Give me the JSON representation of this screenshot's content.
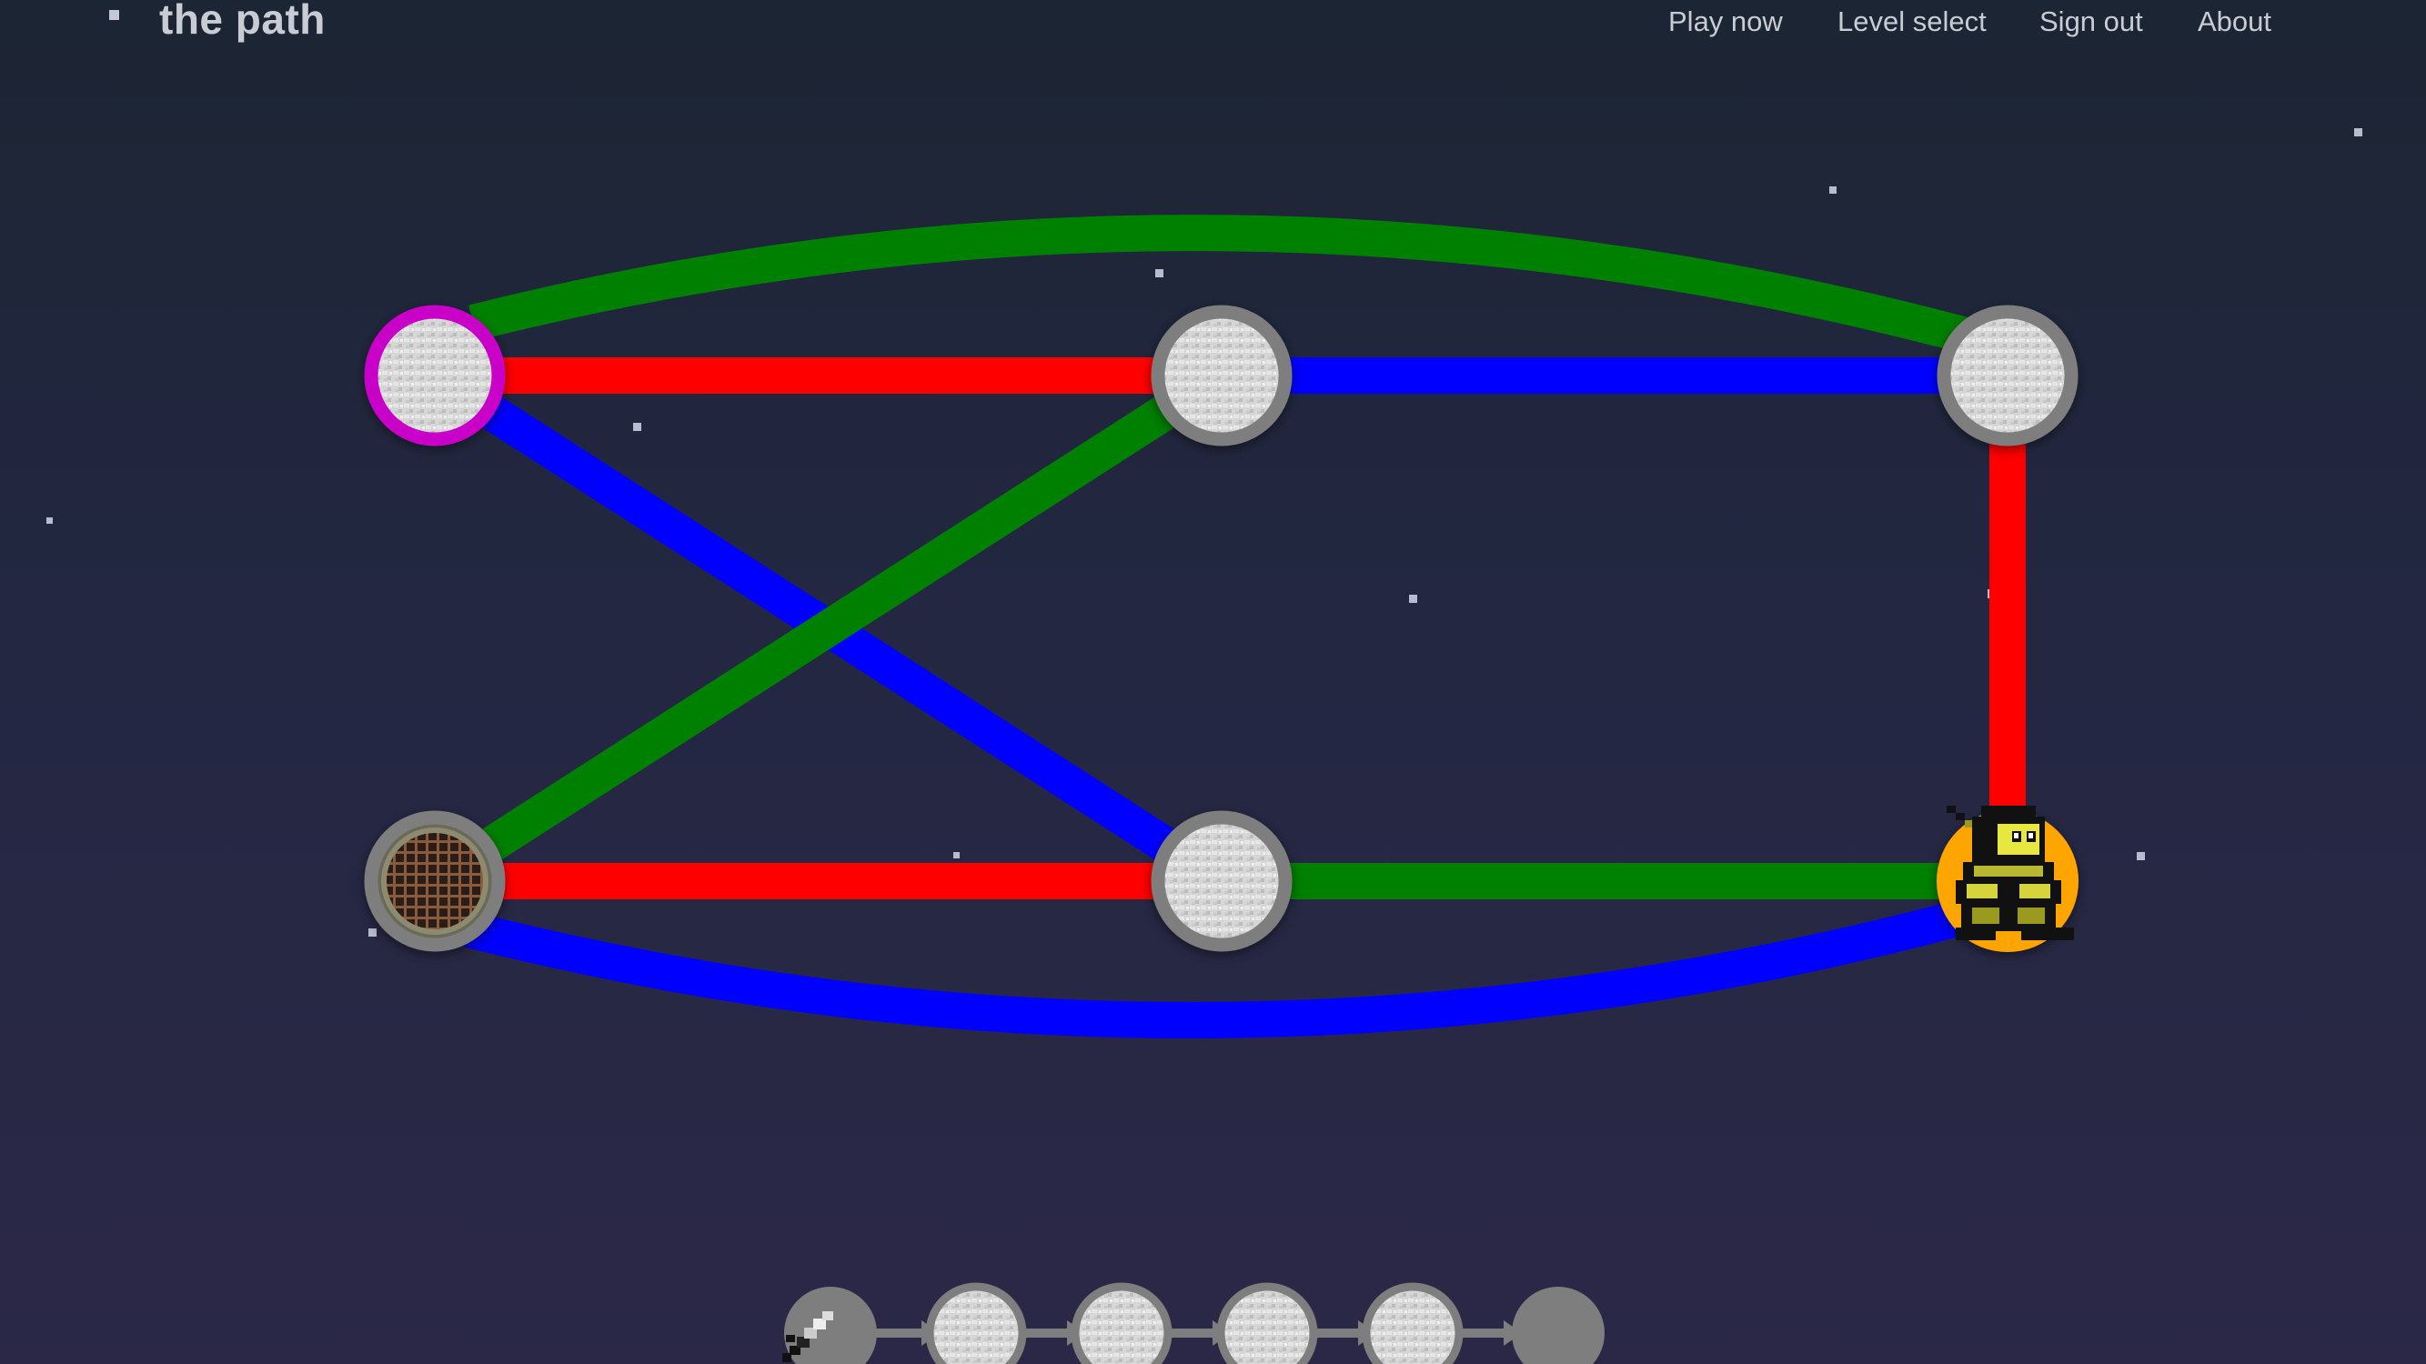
{
  "nav": {
    "title": "the path",
    "links": [
      "Play now",
      "Level select",
      "Sign out",
      "About"
    ]
  },
  "colors": {
    "red": "#ff0000",
    "green": "#008000",
    "blue": "#0000ff",
    "node_ring_default": "#7e7e7e",
    "node_ring_start": "#c800c8",
    "node_ring_player": "#ffa500",
    "stone": "#d4d4d4"
  },
  "board": {
    "nodes": [
      {
        "id": "top-left",
        "state": "start",
        "icon": "stone-icon"
      },
      {
        "id": "top-middle",
        "state": "default",
        "icon": "stone-icon"
      },
      {
        "id": "top-right",
        "state": "default",
        "icon": "stone-icon"
      },
      {
        "id": "bottom-left",
        "state": "default",
        "icon": "sewer-grate-icon"
      },
      {
        "id": "bottom-middle",
        "state": "default",
        "icon": "stone-icon"
      },
      {
        "id": "bottom-right",
        "state": "player",
        "icon": "ninja-character-icon"
      }
    ],
    "edges": [
      {
        "from": "top-left",
        "to": "top-middle",
        "color": "red"
      },
      {
        "from": "top-middle",
        "to": "top-right",
        "color": "blue"
      },
      {
        "from": "top-left",
        "to": "top-right",
        "color": "green"
      },
      {
        "from": "top-right",
        "to": "bottom-right",
        "color": "red"
      },
      {
        "from": "top-left",
        "to": "bottom-middle",
        "color": "blue"
      },
      {
        "from": "top-middle",
        "to": "bottom-left",
        "color": "green"
      },
      {
        "from": "bottom-left",
        "to": "bottom-middle",
        "color": "red"
      },
      {
        "from": "bottom-middle",
        "to": "bottom-right",
        "color": "green"
      },
      {
        "from": "bottom-left",
        "to": "bottom-right",
        "color": "blue"
      }
    ]
  },
  "sequence": {
    "items": [
      "sword-icon",
      "stone-icon",
      "stone-icon",
      "stone-icon",
      "stone-icon",
      "empty-slot"
    ]
  }
}
